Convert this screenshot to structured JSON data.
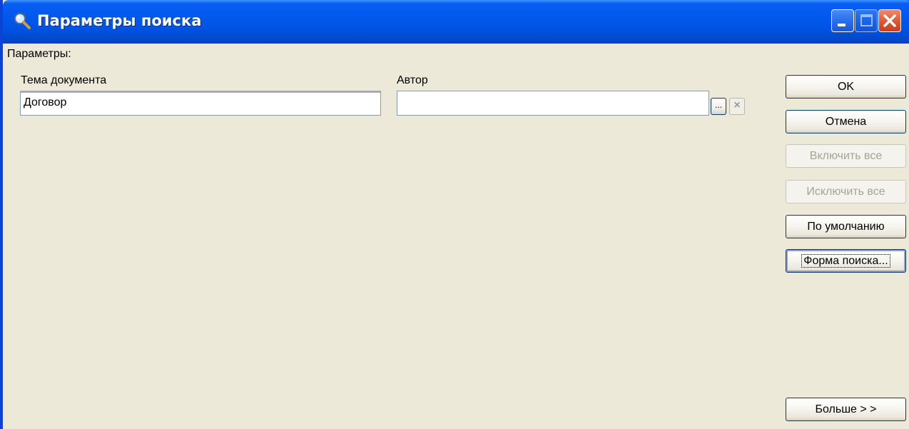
{
  "window": {
    "title": "Параметры поиска"
  },
  "params_label": "Параметры:",
  "fields": {
    "theme": {
      "label": "Тема документа",
      "value": "Договор"
    },
    "author": {
      "label": "Автор",
      "value": "",
      "browse_label": "...",
      "clear_label": "×"
    }
  },
  "buttons": {
    "ok": "OK",
    "cancel": "Отмена",
    "include_all": "Включить все",
    "exclude_all": "Исключить все",
    "default": "По умолчанию",
    "search_form": "Форма поиска...",
    "more": "Больше > >"
  },
  "colors": {
    "titlebar": "#0058ee",
    "dialog_bg": "#ece9d8",
    "button_border": "#003c74",
    "disabled_text": "#a5a494"
  },
  "icons": {
    "title": "magnifier-icon",
    "minimize": "minimize-icon",
    "maximize": "maximize-icon",
    "close": "close-icon"
  }
}
